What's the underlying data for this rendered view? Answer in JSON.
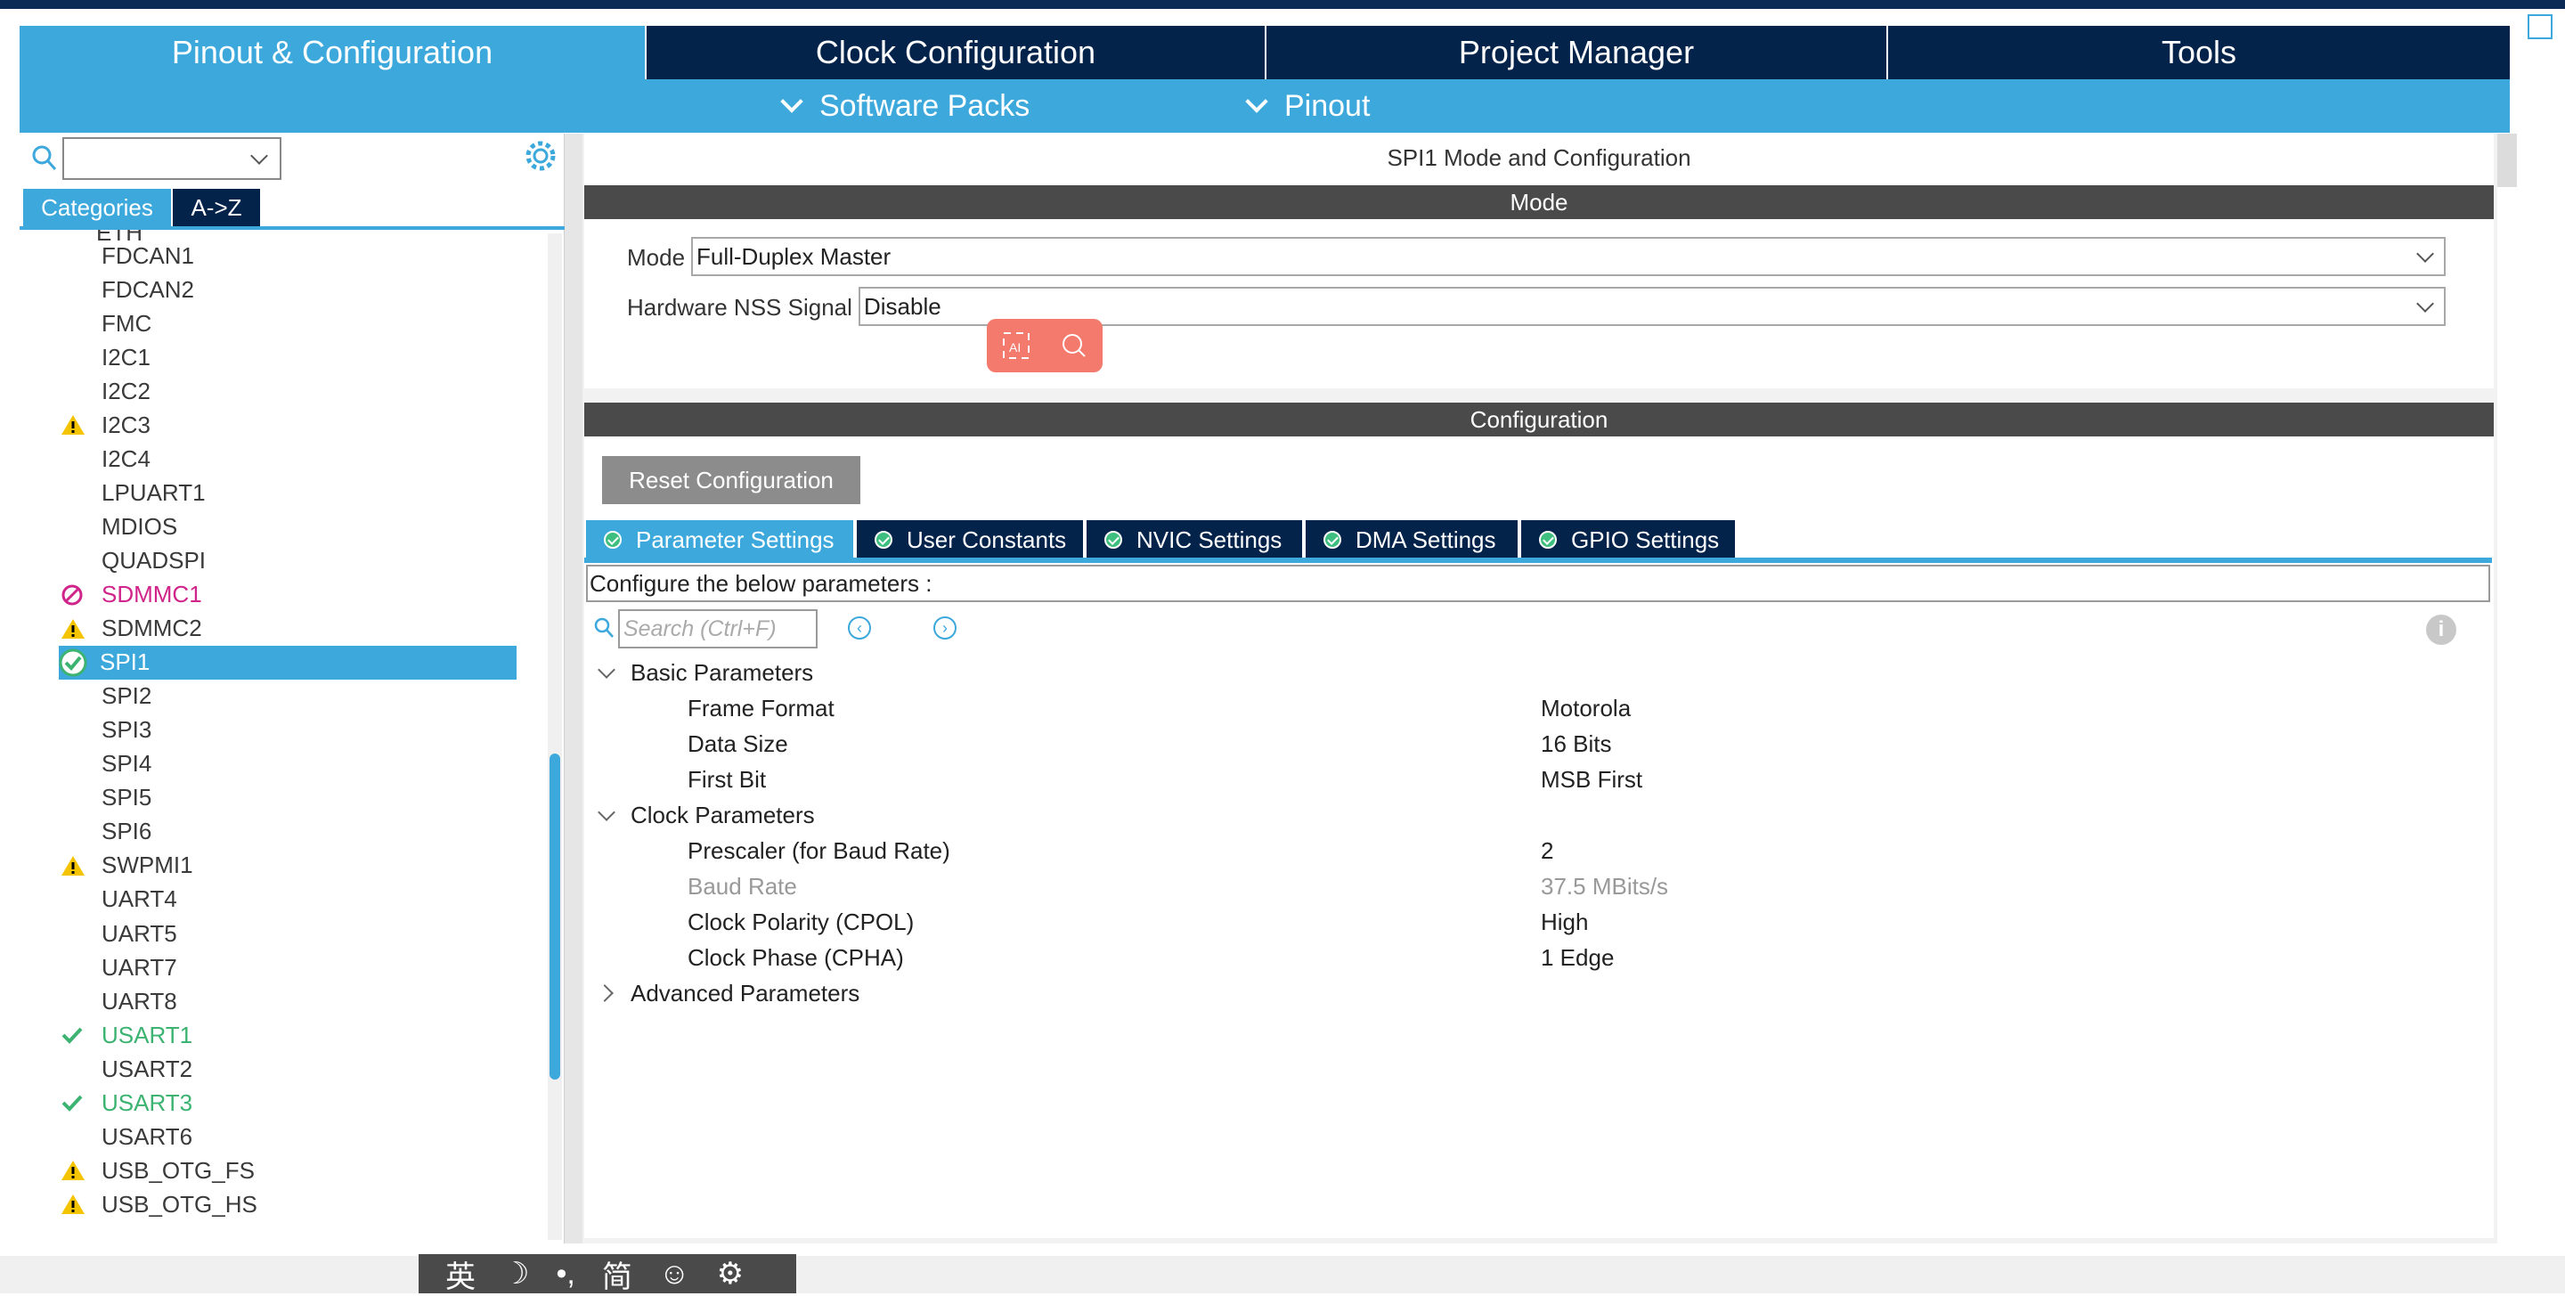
{
  "main_tabs": [
    "Pinout & Configuration",
    "Clock Configuration",
    "Project Manager",
    "Tools"
  ],
  "sub_tabs": [
    "Software Packs",
    "Pinout"
  ],
  "left": {
    "category_tabs": [
      "Categories",
      "A->Z"
    ],
    "partial_top_item": "ETH",
    "items": [
      {
        "label": "FDCAN1",
        "status": "none"
      },
      {
        "label": "FDCAN2",
        "status": "none"
      },
      {
        "label": "FMC",
        "status": "none"
      },
      {
        "label": "I2C1",
        "status": "none"
      },
      {
        "label": "I2C2",
        "status": "none"
      },
      {
        "label": "I2C3",
        "status": "warning"
      },
      {
        "label": "I2C4",
        "status": "none"
      },
      {
        "label": "LPUART1",
        "status": "none"
      },
      {
        "label": "MDIOS",
        "status": "none"
      },
      {
        "label": "QUADSPI",
        "status": "none"
      },
      {
        "label": "SDMMC1",
        "status": "blocked"
      },
      {
        "label": "SDMMC2",
        "status": "warning"
      },
      {
        "label": "SPI1",
        "status": "ok-selected"
      },
      {
        "label": "SPI2",
        "status": "none"
      },
      {
        "label": "SPI3",
        "status": "none"
      },
      {
        "label": "SPI4",
        "status": "none"
      },
      {
        "label": "SPI5",
        "status": "none"
      },
      {
        "label": "SPI6",
        "status": "none"
      },
      {
        "label": "SWPMI1",
        "status": "warning"
      },
      {
        "label": "UART4",
        "status": "none"
      },
      {
        "label": "UART5",
        "status": "none"
      },
      {
        "label": "UART7",
        "status": "none"
      },
      {
        "label": "UART8",
        "status": "none"
      },
      {
        "label": "USART1",
        "status": "ok"
      },
      {
        "label": "USART2",
        "status": "none"
      },
      {
        "label": "USART3",
        "status": "ok"
      },
      {
        "label": "USART6",
        "status": "none"
      },
      {
        "label": "USB_OTG_FS",
        "status": "warning"
      },
      {
        "label": "USB_OTG_HS",
        "status": "warning"
      }
    ]
  },
  "mode_panel": {
    "title": "SPI1 Mode and Configuration",
    "header": "Mode",
    "mode_label": "Mode",
    "mode_value": "Full-Duplex Master",
    "nss_label": "Hardware NSS Signal",
    "nss_value": "Disable"
  },
  "config_panel": {
    "header": "Configuration",
    "reset_button": "Reset Configuration",
    "tabs": [
      "Parameter Settings",
      "User Constants",
      "NVIC Settings",
      "DMA Settings",
      "GPIO Settings"
    ],
    "configure_text": "Configure the below parameters :",
    "search_placeholder": "Search (Ctrl+F)",
    "groups": [
      {
        "name": "Basic Parameters",
        "expanded": true,
        "params": [
          {
            "name": "Frame Format",
            "value": "Motorola",
            "muted": false
          },
          {
            "name": "Data Size",
            "value": "16 Bits",
            "muted": false
          },
          {
            "name": "First Bit",
            "value": "MSB First",
            "muted": false
          }
        ]
      },
      {
        "name": "Clock Parameters",
        "expanded": true,
        "params": [
          {
            "name": "Prescaler (for Baud Rate)",
            "value": "2",
            "muted": false
          },
          {
            "name": "Baud Rate",
            "value": "37.5 MBits/s",
            "muted": true
          },
          {
            "name": "Clock Polarity (CPOL)",
            "value": "High",
            "muted": false
          },
          {
            "name": "Clock Phase (CPHA)",
            "value": "1 Edge",
            "muted": false
          }
        ]
      },
      {
        "name": "Advanced Parameters",
        "expanded": false,
        "params": []
      }
    ]
  },
  "taskbar": [
    "英",
    "☽",
    "•,",
    "简",
    "☺",
    "⚙"
  ],
  "colors": {
    "accent": "#3ca8dc",
    "dark": "#03234b",
    "header": "#4a4a4a",
    "warning": "#f5c400",
    "ok": "#3cb371",
    "blocked": "#d0248a"
  }
}
